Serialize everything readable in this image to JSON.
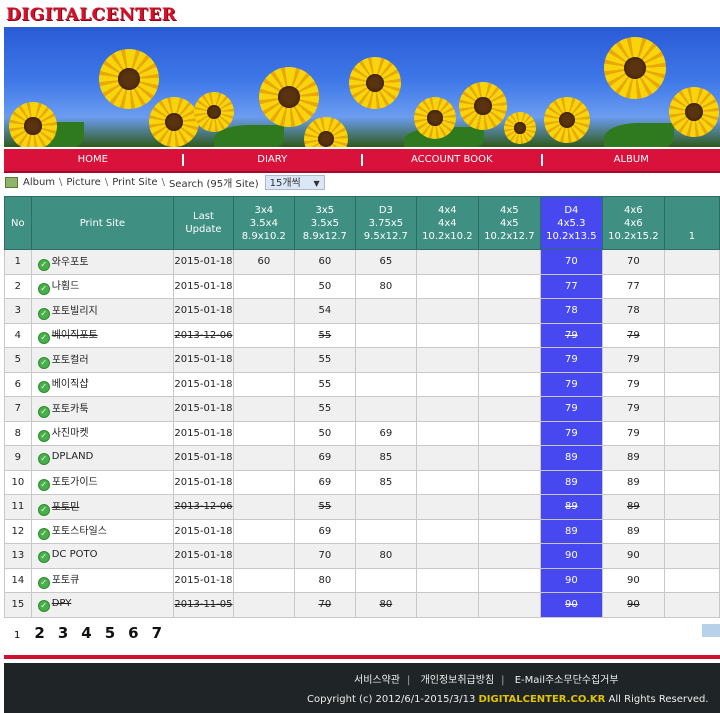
{
  "logo": "DIGITALCENTER",
  "nav": [
    "HOME",
    "DIARY",
    "ACCOUNT BOOK",
    "ALBUM"
  ],
  "breadcrumb": [
    "Album",
    "Picture",
    "Print Site",
    "Search (95개 Site)"
  ],
  "per_page": "15개씩",
  "columns": {
    "no": "No",
    "site": "Print Site",
    "update": "Last Update",
    "sizes": [
      {
        "l1": "3x4",
        "l2": "3.5x4",
        "l3": "8.9x10.2"
      },
      {
        "l1": "3x5",
        "l2": "3.5x5",
        "l3": "8.9x12.7"
      },
      {
        "l1": "D3",
        "l2": "3.75x5",
        "l3": "9.5x12.7"
      },
      {
        "l1": "4x4",
        "l2": "4x4",
        "l3": "10.2x10.2"
      },
      {
        "l1": "4x5",
        "l2": "4x5",
        "l3": "10.2x12.7"
      },
      {
        "l1": "D4",
        "l2": "4x5.3",
        "l3": "10.2x13.5"
      },
      {
        "l1": "4x6",
        "l2": "4x6",
        "l3": "10.2x15.2"
      },
      {
        "l1": "",
        "l2": "",
        "l3": "1"
      }
    ]
  },
  "rows": [
    {
      "no": "1",
      "site": "와우포토",
      "date": "2015-01-18",
      "v": [
        "60",
        "60",
        "65",
        "",
        "",
        "70",
        "70",
        ""
      ],
      "strike": false
    },
    {
      "no": "2",
      "site": "나횜드",
      "date": "2015-01-18",
      "v": [
        "",
        "50",
        "80",
        "",
        "",
        "77",
        "77",
        ""
      ],
      "strike": false
    },
    {
      "no": "3",
      "site": "포토빌리지",
      "date": "2015-01-18",
      "v": [
        "",
        "54",
        "",
        "",
        "",
        "78",
        "78",
        ""
      ],
      "strike": false
    },
    {
      "no": "4",
      "site": "베이직포토",
      "date": "2013-12-06",
      "v": [
        "",
        "55",
        "",
        "",
        "",
        "79",
        "79",
        ""
      ],
      "strike": true
    },
    {
      "no": "5",
      "site": "포토컬러",
      "date": "2015-01-18",
      "v": [
        "",
        "55",
        "",
        "",
        "",
        "79",
        "79",
        ""
      ],
      "strike": false
    },
    {
      "no": "6",
      "site": "베이직샵",
      "date": "2015-01-18",
      "v": [
        "",
        "55",
        "",
        "",
        "",
        "79",
        "79",
        ""
      ],
      "strike": false
    },
    {
      "no": "7",
      "site": "포토카툭",
      "date": "2015-01-18",
      "v": [
        "",
        "55",
        "",
        "",
        "",
        "79",
        "79",
        ""
      ],
      "strike": false
    },
    {
      "no": "8",
      "site": "사진마켓",
      "date": "2015-01-18",
      "v": [
        "",
        "50",
        "69",
        "",
        "",
        "79",
        "79",
        ""
      ],
      "strike": false
    },
    {
      "no": "9",
      "site": "DPLAND",
      "date": "2015-01-18",
      "v": [
        "",
        "69",
        "85",
        "",
        "",
        "89",
        "89",
        ""
      ],
      "strike": false
    },
    {
      "no": "10",
      "site": "포토가이드",
      "date": "2015-01-18",
      "v": [
        "",
        "69",
        "85",
        "",
        "",
        "89",
        "89",
        ""
      ],
      "strike": false
    },
    {
      "no": "11",
      "site": "포토민",
      "date": "2013-12-06",
      "v": [
        "",
        "55",
        "",
        "",
        "",
        "89",
        "89",
        ""
      ],
      "strike": true
    },
    {
      "no": "12",
      "site": "포토스타일스",
      "date": "2015-01-18",
      "v": [
        "",
        "69",
        "",
        "",
        "",
        "89",
        "89",
        ""
      ],
      "strike": false
    },
    {
      "no": "13",
      "site": "DC POTO",
      "date": "2015-01-18",
      "v": [
        "",
        "70",
        "80",
        "",
        "",
        "90",
        "90",
        ""
      ],
      "strike": false
    },
    {
      "no": "14",
      "site": "포토큐",
      "date": "2015-01-18",
      "v": [
        "",
        "80",
        "",
        "",
        "",
        "90",
        "90",
        ""
      ],
      "strike": false
    },
    {
      "no": "15",
      "site": "DPY",
      "date": "2013-11-05",
      "v": [
        "",
        "70",
        "80",
        "",
        "",
        "90",
        "90",
        ""
      ],
      "strike": true
    }
  ],
  "pagination": {
    "current": "1",
    "pages": [
      "2",
      "3",
      "4",
      "5",
      "6",
      "7"
    ]
  },
  "footer": {
    "links": [
      "서비스약관",
      "개인정보취급방침",
      "E-Mail주소무단수집거부"
    ],
    "copy_prefix": "Copyright (c) 2012/6/1-2015/3/13 ",
    "brand": "DIGITALCENTER.CO.KR",
    "copy_suffix": " All Rights Reserved."
  },
  "colors": {
    "accent": "#d8123a",
    "header": "#3f8f82",
    "highlight": "#4848f0",
    "footer": "#1f2426"
  },
  "icons": [
    "album-icon",
    "check-circle-icon"
  ]
}
